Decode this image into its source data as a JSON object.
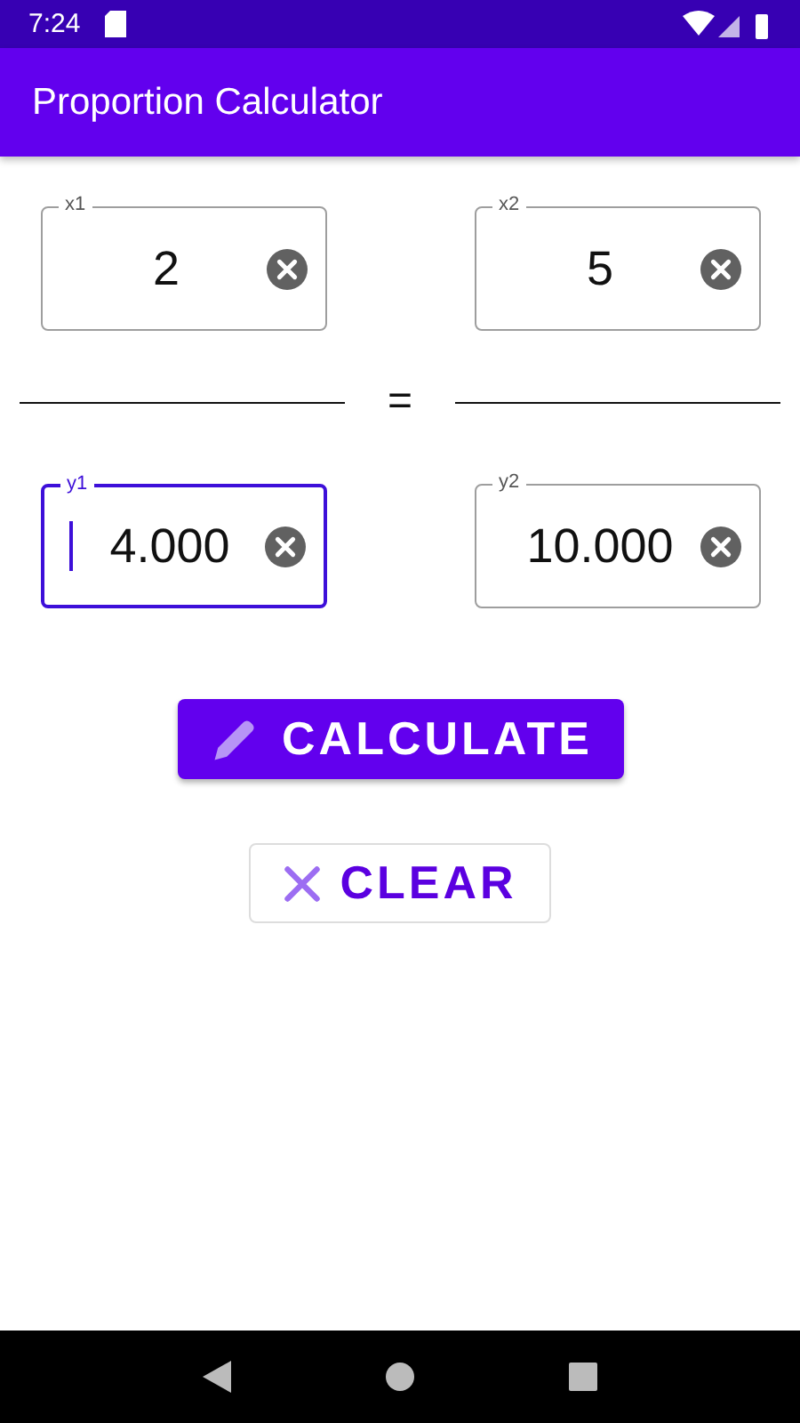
{
  "status_bar": {
    "time": "7:24"
  },
  "app_bar": {
    "title": "Proportion Calculator"
  },
  "numerators": [
    {
      "label": "x1",
      "value": "2",
      "focused": false
    },
    {
      "label": "x2",
      "value": "5",
      "focused": false
    }
  ],
  "equals": "=",
  "denominators": [
    {
      "label": "y1",
      "value": "4.000",
      "focused": true
    },
    {
      "label": "y2",
      "value": "10.000",
      "focused": false
    }
  ],
  "buttons": [
    {
      "kind": "primary",
      "label": "CALCULATE"
    },
    {
      "kind": "outlined",
      "label": "CLEAR"
    }
  ]
}
